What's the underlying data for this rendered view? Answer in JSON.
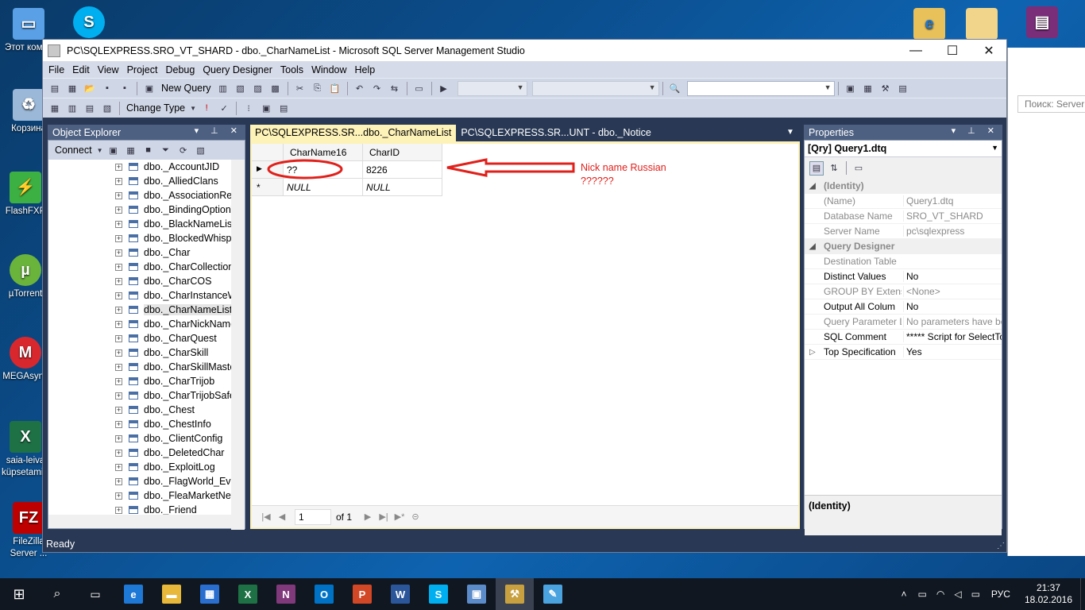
{
  "desktop": {
    "icons": [
      {
        "label": "Этот компьютер",
        "icon": "computer-icon",
        "color": "#5aa0e6"
      },
      {
        "label": "Корзина",
        "icon": "recycle-bin-icon",
        "color": "#9bb8d8"
      },
      {
        "label": "FlashFXP",
        "icon": "flashfxp-icon",
        "color": "#3cb043"
      },
      {
        "label": "µTorrent",
        "icon": "utorrent-icon",
        "color": "#6ab43c"
      },
      {
        "label": "MEGAsync",
        "icon": "mega-icon",
        "color": "#d9272e"
      },
      {
        "label": "saia-leiva küpsetamine",
        "icon": "excel-file-icon",
        "color": "#1e7145"
      },
      {
        "label": "FileZilla Server ...",
        "icon": "filezilla-icon",
        "color": "#bf0000"
      }
    ],
    "bg_window_search_placeholder": "Поиск: Server"
  },
  "window": {
    "title": "PC\\SQLEXPRESS.SRO_VT_SHARD - dbo._CharNameList - Microsoft SQL Server Management Studio",
    "menu": [
      "File",
      "Edit",
      "View",
      "Project",
      "Debug",
      "Query Designer",
      "Tools",
      "Window",
      "Help"
    ],
    "toolbar": {
      "new_query": "New Query",
      "change_type": "Change Type"
    },
    "status": "Ready"
  },
  "object_explorer": {
    "title": "Object Explorer",
    "connect": "Connect",
    "tables": [
      "dbo._AccountJID",
      "dbo._AlliedClans",
      "dbo._AssociationRep",
      "dbo._BindingOptionW",
      "dbo._BlackNameList",
      "dbo._BlockedWhispe",
      "dbo._Char",
      "dbo._CharCollectionB",
      "dbo._CharCOS",
      "dbo._CharInstanceW",
      "dbo._CharNameList",
      "dbo._CharNickName",
      "dbo._CharQuest",
      "dbo._CharSkill",
      "dbo._CharSkillMaster",
      "dbo._CharTrijob",
      "dbo._CharTrijobSafeT",
      "dbo._Chest",
      "dbo._ChestInfo",
      "dbo._ClientConfig",
      "dbo._DeletedChar",
      "dbo._ExploitLog",
      "dbo._FlagWorld_Ever",
      "dbo._FleaMarketNetw",
      "dbo._Friend"
    ],
    "selected_index": 10
  },
  "tabs": [
    {
      "label": "PC\\SQLEXPRESS.SR...dbo._CharNameList",
      "active": true
    },
    {
      "label": "PC\\SQLEXPRESS.SR...UNT - dbo._Notice",
      "active": false
    }
  ],
  "grid": {
    "columns": [
      "CharName16",
      "CharID"
    ],
    "rows": [
      {
        "marker": "▶",
        "cells": [
          "??",
          "8226"
        ]
      },
      {
        "marker": "*",
        "cells": [
          "NULL",
          "NULL"
        ]
      }
    ],
    "annotation": [
      "Nick name Russian",
      "??????"
    ],
    "annotation_color": "#e0201b",
    "nav": {
      "page": "1",
      "of": "of 1"
    }
  },
  "properties": {
    "title": "Properties",
    "object": "[Qry] Query1.dtq",
    "rows": [
      {
        "type": "cat",
        "key": "(Identity)"
      },
      {
        "type": "dim",
        "key": "(Name)",
        "value": "Query1.dtq"
      },
      {
        "type": "dim",
        "key": "Database Name",
        "value": "SRO_VT_SHARD"
      },
      {
        "type": "dim",
        "key": "Server Name",
        "value": "pc\\sqlexpress"
      },
      {
        "type": "cat",
        "key": "Query Designer"
      },
      {
        "type": "dim",
        "key": "Destination Table",
        "value": ""
      },
      {
        "type": "prop",
        "key": "Distinct Values",
        "value": "No"
      },
      {
        "type": "dim",
        "key": "GROUP BY Extensi",
        "value": "<None>"
      },
      {
        "type": "prop",
        "key": "Output All Colum",
        "value": "No"
      },
      {
        "type": "dim",
        "key": "Query Parameter L",
        "value": "No parameters have been"
      },
      {
        "type": "prop",
        "key": "SQL Comment",
        "value": "***** Script for SelectTo"
      },
      {
        "type": "prop",
        "key": "Top Specification",
        "value": "Yes",
        "expandable": true
      }
    ],
    "description": "(Identity)"
  },
  "taskbar": {
    "apps": [
      {
        "name": "edge-icon",
        "color": "#1e78d6",
        "glyph": "e"
      },
      {
        "name": "file-explorer-icon",
        "color": "#e8b83a",
        "glyph": "▬"
      },
      {
        "name": "store-icon",
        "color": "#2a6fcf",
        "glyph": "▦"
      },
      {
        "name": "excel-icon",
        "color": "#1e7145",
        "glyph": "X"
      },
      {
        "name": "onenote-icon",
        "color": "#80397b",
        "glyph": "N"
      },
      {
        "name": "outlook-icon",
        "color": "#0072c6",
        "glyph": "O"
      },
      {
        "name": "powerpoint-icon",
        "color": "#d24726",
        "glyph": "P"
      },
      {
        "name": "word-icon",
        "color": "#2b579a",
        "glyph": "W"
      },
      {
        "name": "skype-icon",
        "color": "#00aff0",
        "glyph": "S"
      },
      {
        "name": "control-panel-icon",
        "color": "#5b8bc8",
        "glyph": "▣"
      },
      {
        "name": "ssms-icon",
        "color": "#c8a040",
        "glyph": "⚒"
      },
      {
        "name": "paint-icon",
        "color": "#4aa3df",
        "glyph": "✎"
      }
    ],
    "lang": "РУС",
    "time": "21:37",
    "date": "18.02.2016"
  }
}
